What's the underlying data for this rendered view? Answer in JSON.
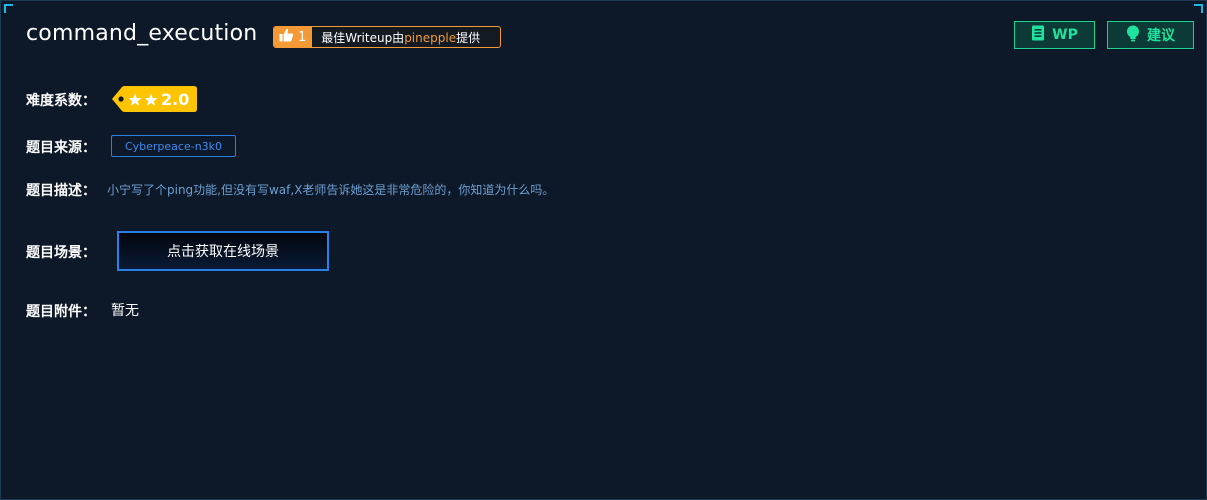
{
  "challenge": {
    "title": "command_execution",
    "writeup_badge": {
      "count": "1",
      "text_prefix": "最佳Writeup由",
      "author": "pinepple",
      "text_suffix": "提供"
    },
    "buttons": {
      "wp_label": "WP",
      "suggest_label": "建议"
    }
  },
  "details": {
    "difficulty_label": "难度系数：",
    "difficulty_value": "2.0",
    "difficulty_stars": 2,
    "source_label": "题目来源：",
    "source_value": "Cyberpeace-n3k0",
    "description_label": "题目描述：",
    "description_value": "小宁写了个ping功能,但没有写waf,X老师告诉她这是非常危险的，你知道为什么吗。",
    "scene_label": "题目场景：",
    "scene_button_label": "点击获取在线场景",
    "attachment_label": "题目附件：",
    "attachment_value": "暂无"
  },
  "colors": {
    "background": "#0d1928",
    "accent_orange": "#f39a36",
    "accent_green": "#1fe39c",
    "accent_blue": "#2b7fe8",
    "difficulty_yellow": "#ffc400"
  },
  "icons": [
    "thumbs-up-icon",
    "document-icon",
    "lightbulb-icon",
    "star-icon"
  ]
}
